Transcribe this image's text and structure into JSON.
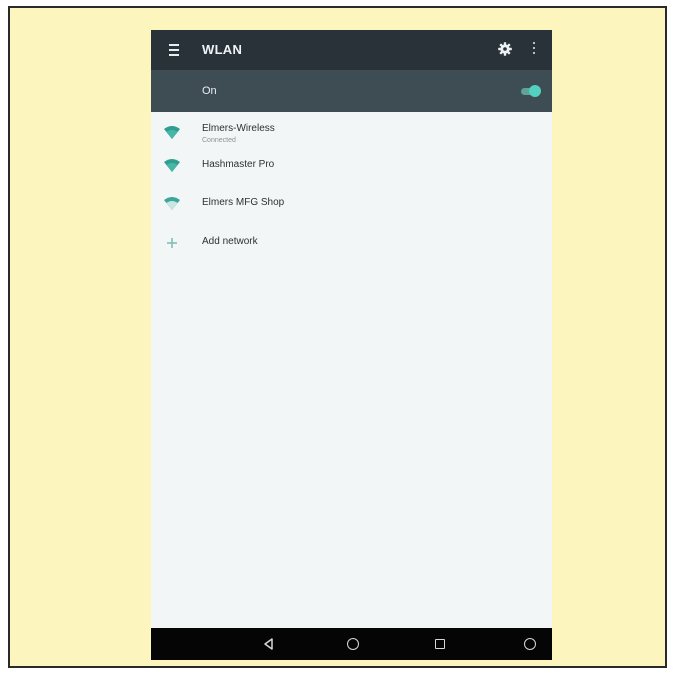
{
  "toolbar": {
    "title": "WLAN",
    "menu_icon": "menu-icon",
    "settings_icon": "gear-icon",
    "overflow_icon": "more-vert-icon"
  },
  "master_switch": {
    "label": "On",
    "state": "on",
    "accent": "#52d1c1"
  },
  "networks": [
    {
      "name": "Elmers-Wireless",
      "status": "Connected",
      "icon": "wifi-signal-icon"
    },
    {
      "name": "Hashmaster Pro",
      "icon": "wifi-signal-icon"
    },
    {
      "name": "Elmers MFG Shop",
      "icon": "wifi-signal-icon"
    }
  ],
  "add_network": {
    "label": "Add network",
    "icon": "plus-icon"
  },
  "nav_bar": {
    "back_icon": "back-icon",
    "home_icon": "home-icon",
    "recents_icon": "recents-icon",
    "assistant_icon": "assistant-icon"
  },
  "colors": {
    "frame_bg": "#fcf5bd",
    "toolbar_bg": "#283238",
    "switchbar_bg": "#3e4c53",
    "content_bg": "#f3f6f7",
    "wifi_icon": "#2e9e8f"
  }
}
